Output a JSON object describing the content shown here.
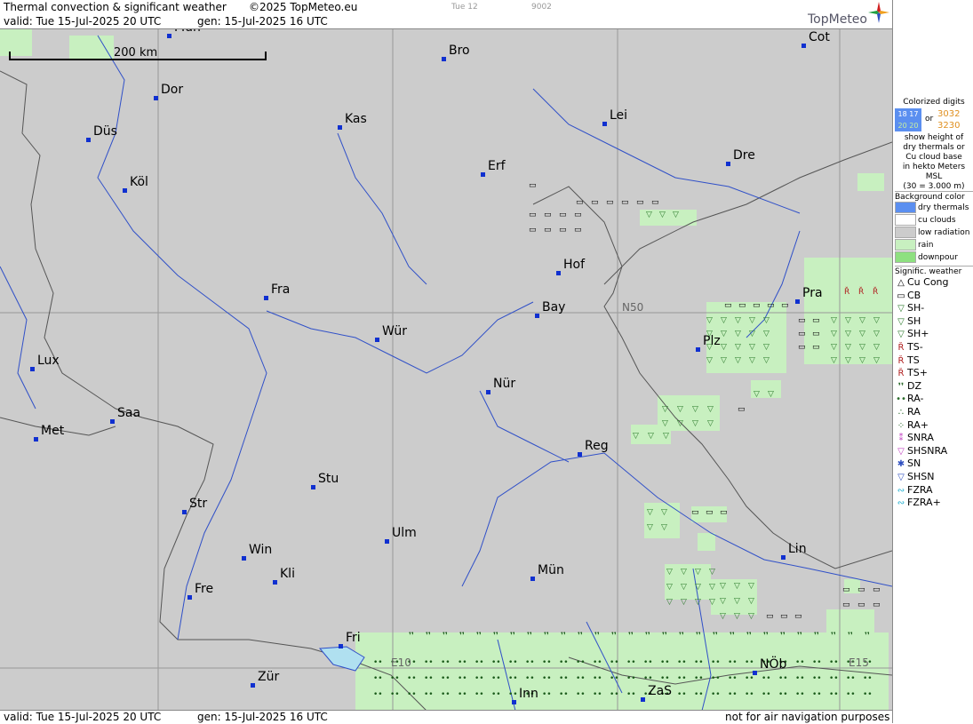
{
  "header": {
    "title": "Thermal convection & significant weather",
    "copyright": "©2025 TopMeteo.eu",
    "day": "Tue 12",
    "code": "9002",
    "valid": "valid:  Tue  15-Jul-2025  20 UTC",
    "gen": "gen: 15-Jul-2025 16 UTC",
    "logo": "TopMeteo"
  },
  "footer": {
    "valid": "valid:  Tue  15-Jul-2025  20 UTC",
    "gen": "gen: 15-Jul-2025 16 UTC",
    "note": "not for air navigation purposes"
  },
  "scale_label": "200 km",
  "grid_labels": {
    "e10": "E10",
    "e15": "E15",
    "n50": "N50"
  },
  "cities": [
    {
      "name": "Mün",
      "label": "Mün",
      "top": true
    },
    {
      "name": "Bro",
      "label": "Bro"
    },
    {
      "name": "Cot",
      "label": "Cot"
    },
    {
      "name": "Dor",
      "label": "Dor"
    },
    {
      "name": "Kas",
      "label": "Kas"
    },
    {
      "name": "Lei",
      "label": "Lei"
    },
    {
      "name": "Düs",
      "label": "Düs"
    },
    {
      "name": "Dre",
      "label": "Dre"
    },
    {
      "name": "Erf",
      "label": "Erf"
    },
    {
      "name": "Köl",
      "label": "Köl"
    },
    {
      "name": "Hof",
      "label": "Hof"
    },
    {
      "name": "Fra",
      "label": "Fra"
    },
    {
      "name": "Pra",
      "label": "Pra"
    },
    {
      "name": "Bay",
      "label": "Bay"
    },
    {
      "name": "Wür",
      "label": "Wür"
    },
    {
      "name": "Plz",
      "label": "Plz"
    },
    {
      "name": "Lux",
      "label": "Lux"
    },
    {
      "name": "Nür",
      "label": "Nür"
    },
    {
      "name": "Saa",
      "label": "Saa"
    },
    {
      "name": "Met",
      "label": "Met"
    },
    {
      "name": "Reg",
      "label": "Reg"
    },
    {
      "name": "Stu",
      "label": "Stu"
    },
    {
      "name": "Str",
      "label": "Str"
    },
    {
      "name": "Ulm",
      "label": "Ulm"
    },
    {
      "name": "Lin",
      "label": "Lin"
    },
    {
      "name": "Win",
      "label": "Win"
    },
    {
      "name": "Kli",
      "label": "Kli"
    },
    {
      "name": "Mün2",
      "label": "Mün"
    },
    {
      "name": "Fre",
      "label": "Fre"
    },
    {
      "name": "Fri",
      "label": "Fri"
    },
    {
      "name": "NÖb",
      "label": "NÖb"
    },
    {
      "name": "Zür",
      "label": "Zür"
    },
    {
      "name": "ZaS",
      "label": "ZaS"
    },
    {
      "name": "Inn",
      "label": "Inn"
    }
  ],
  "legend": {
    "digits_title": "Colorized digits",
    "digits_a": "18 17",
    "digits_b": "20 20",
    "or": "or",
    "digits_c": "3032",
    "digits_d": "3230",
    "digits_desc": [
      "show height of",
      "dry thermals or",
      "Cu cloud base",
      "in hekto Meters",
      "MSL",
      "(30 = 3.000 m)"
    ],
    "bg_title": "Background color",
    "bg_items": [
      {
        "label": "dry thermals",
        "color": "#5b8ff0"
      },
      {
        "label": "cu clouds",
        "color": "#ffffff"
      },
      {
        "label": "low radiation",
        "color": "#cccccc"
      },
      {
        "label": "rain",
        "color": "#c8f0c0"
      },
      {
        "label": "downpour",
        "color": "#8ee080"
      }
    ],
    "sig_title": "Signific. weather",
    "sig_items": [
      {
        "label": "Cu Cong",
        "icon": "cu-cong-icon",
        "glyph": "△",
        "color": "#000"
      },
      {
        "label": "CB",
        "icon": "cb-icon",
        "glyph": "▭",
        "color": "#000"
      },
      {
        "label": "SH-",
        "icon": "showers-light-icon",
        "glyph": "▽",
        "color": "#2a7a2a"
      },
      {
        "label": "SH",
        "icon": "showers-icon",
        "glyph": "▽",
        "color": "#2a7a2a"
      },
      {
        "label": "SH+",
        "icon": "showers-heavy-icon",
        "glyph": "▽",
        "color": "#2a7a2a"
      },
      {
        "label": "TS-",
        "icon": "thunderstorm-light-icon",
        "glyph": "Ř",
        "color": "#b02020"
      },
      {
        "label": "TS",
        "icon": "thunderstorm-icon",
        "glyph": "Ř",
        "color": "#b02020"
      },
      {
        "label": "TS+",
        "icon": "thunderstorm-heavy-icon",
        "glyph": "Ř",
        "color": "#b02020"
      },
      {
        "label": "DZ",
        "icon": "drizzle-icon",
        "glyph": "❜❜",
        "color": "#2a6a2a"
      },
      {
        "label": "RA-",
        "icon": "rain-light-icon",
        "glyph": "••",
        "color": "#2a6a2a"
      },
      {
        "label": "RA",
        "icon": "rain-icon",
        "glyph": "∴",
        "color": "#2a6a2a"
      },
      {
        "label": "RA+",
        "icon": "rain-heavy-icon",
        "glyph": "⁘",
        "color": "#2a6a2a"
      },
      {
        "label": "SNRA",
        "icon": "snow-rain-icon",
        "glyph": "⁑",
        "color": "#c040c0"
      },
      {
        "label": "SHSNRA",
        "icon": "snow-rain-showers-icon",
        "glyph": "▽",
        "color": "#c040c0"
      },
      {
        "label": "SN",
        "icon": "snow-icon",
        "glyph": "✱",
        "color": "#3050c0"
      },
      {
        "label": "SHSN",
        "icon": "snow-showers-icon",
        "glyph": "▽",
        "color": "#3050c0"
      },
      {
        "label": "FZRA",
        "icon": "freezing-rain-icon",
        "glyph": "∾",
        "color": "#20b0d0"
      },
      {
        "label": "FZRA+",
        "icon": "freezing-rain-heavy-icon",
        "glyph": "∾",
        "color": "#20b0d0"
      }
    ]
  }
}
